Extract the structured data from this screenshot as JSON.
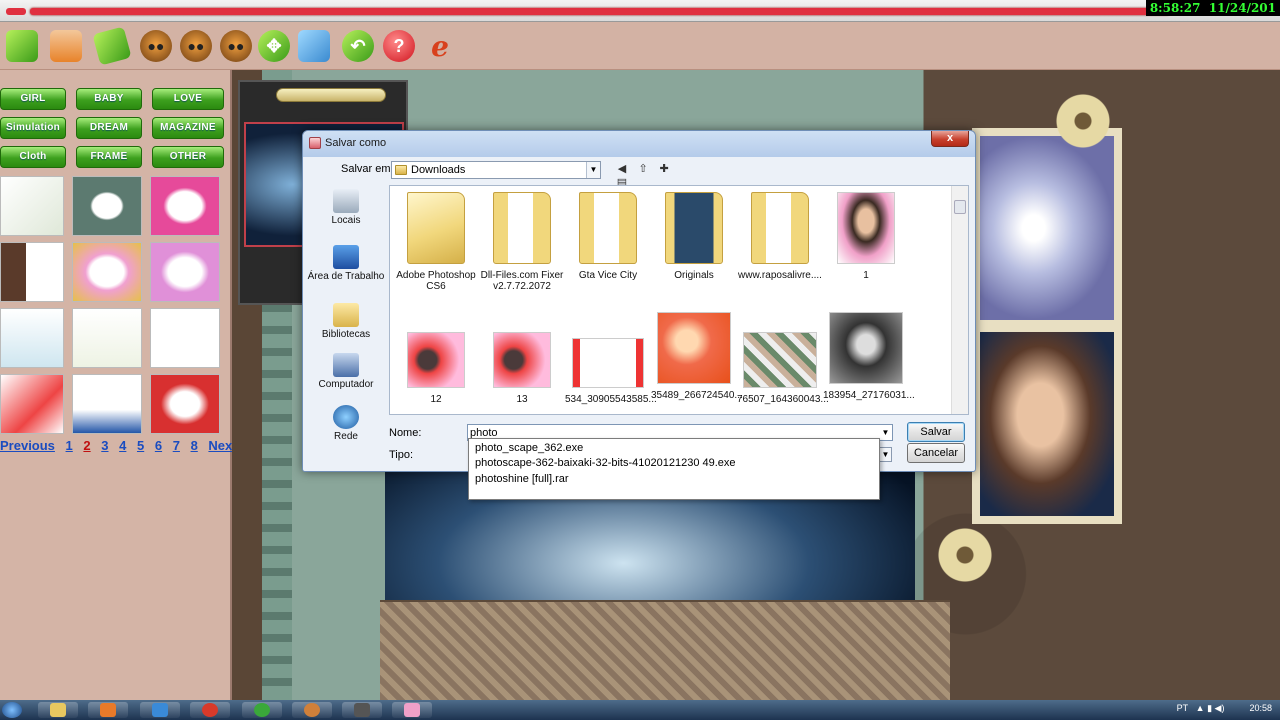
{
  "clock": {
    "time": "8:58:27",
    "date": "11/24/201"
  },
  "toolbar": {
    "icons": [
      "note-icon",
      "folder-icon",
      "pencil-icon",
      "owl-icon",
      "owl-icon",
      "disc-owl-icon",
      "move-arrows-icon",
      "bird-icon",
      "undo-icon",
      "help-icon",
      "internet-explorer-icon"
    ],
    "help_glyph": "?",
    "ie_glyph": "e"
  },
  "categories": [
    "GIRL",
    "BABY",
    "LOVE",
    "Simulation",
    "DREAM",
    "MAGAZINE",
    "Cloth",
    "FRAME",
    "OTHER"
  ],
  "pager": {
    "previous": "Previous",
    "pages": [
      "1",
      "2",
      "3",
      "4",
      "5",
      "6",
      "7",
      "8"
    ],
    "current": "2",
    "next": "Next"
  },
  "dialog": {
    "title": "Salvar como",
    "close_glyph": "x",
    "save_in_label": "Salvar em:",
    "save_in_value": "Downloads",
    "places": [
      "Locais",
      "Área de Trabalho",
      "Bibliotecas",
      "Computador",
      "Rede"
    ],
    "files": [
      {
        "name": "Adobe Photoshop CS6",
        "kind": "folder"
      },
      {
        "name": "Dll-Files.com Fixer v2.7.72.2072",
        "kind": "folder-doc"
      },
      {
        "name": "Gta Vice City",
        "kind": "folder-doc"
      },
      {
        "name": "Originals",
        "kind": "folder-photo"
      },
      {
        "name": "www.raposalivre....",
        "kind": "folder-doc"
      },
      {
        "name": "1",
        "kind": "photo"
      },
      {
        "name": "12",
        "kind": "photo"
      },
      {
        "name": "13",
        "kind": "photo"
      },
      {
        "name": "534_30905543585...",
        "kind": "photo"
      },
      {
        "name": "35489_266724540...",
        "kind": "photo"
      },
      {
        "name": "76507_164360043...",
        "kind": "photo"
      },
      {
        "name": "183954_27176031...",
        "kind": "photo"
      }
    ],
    "name_label": "Nome:",
    "name_value": "photo",
    "type_label": "Tipo:",
    "save_button": "Salvar",
    "cancel_button": "Cancelar",
    "suggestions": [
      "photo_scape_362.exe",
      "photoscape-362-baixaki-32-bits-41020121230 49.exe",
      "photoshine [full].rar"
    ]
  },
  "taskbar": {
    "lang": "PT",
    "time": "20:58"
  }
}
